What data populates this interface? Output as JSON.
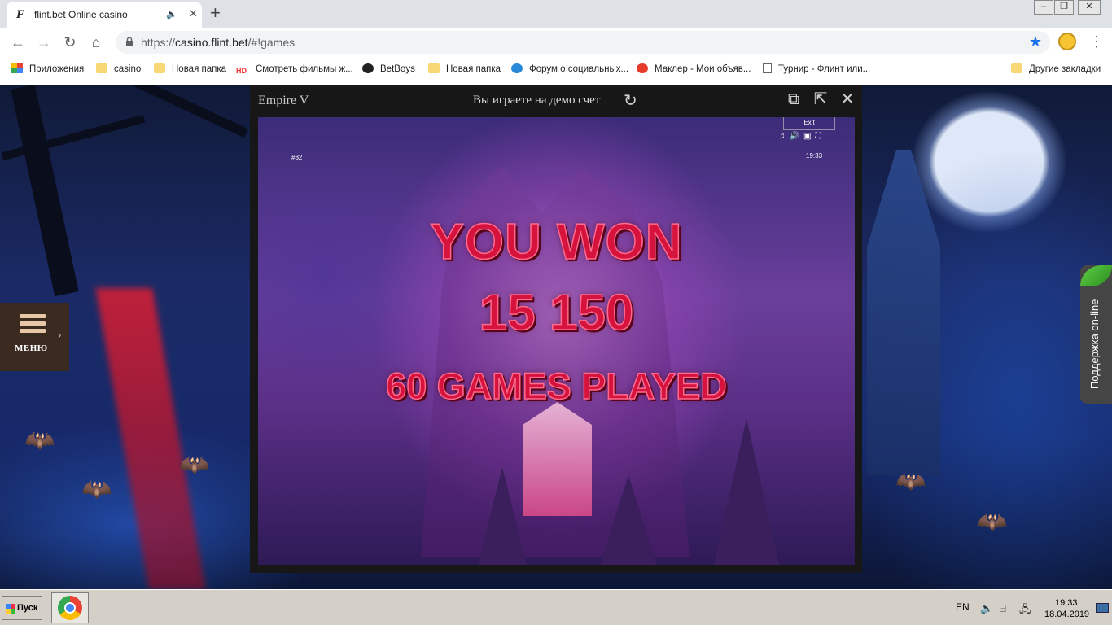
{
  "browser": {
    "tab_title": "flint.bet Online casino",
    "url_prefix": "https://",
    "url_domain": "casino.flint.bet",
    "url_path": "/#!games",
    "bookmarks": [
      {
        "label": "Приложения",
        "icon": "apps-icon"
      },
      {
        "label": "casino",
        "icon": "folder-icon"
      },
      {
        "label": "Новая папка",
        "icon": "folder-icon"
      },
      {
        "label": "Смотреть фильмы ж...",
        "icon": "hd-icon"
      },
      {
        "label": "BetBoys",
        "icon": "betboys-icon"
      },
      {
        "label": "Новая папка",
        "icon": "folder-icon"
      },
      {
        "label": "Форум о социальных...",
        "icon": "z-icon"
      },
      {
        "label": "Маклер - Мои объяв...",
        "icon": "flower-icon"
      },
      {
        "label": "Турнир - Флинт или...",
        "icon": "page-icon"
      },
      {
        "label": "Другие закладки",
        "icon": "folder-icon"
      }
    ]
  },
  "page": {
    "menu_label": "МЕНЮ",
    "support_label": "Поддержка on-line"
  },
  "modal": {
    "game_title": "Empire V",
    "demo_notice": "Вы играете на демо счет"
  },
  "game": {
    "exit_label": "Exit",
    "round_id": "#82",
    "time": "19:33",
    "win_line1": "YOU WON",
    "win_amount": "15 150",
    "games_played": "60 GAMES PLAYED"
  },
  "taskbar": {
    "start_label": "Пуск",
    "lang": "EN",
    "time": "19:33",
    "date": "18.04.2019"
  }
}
